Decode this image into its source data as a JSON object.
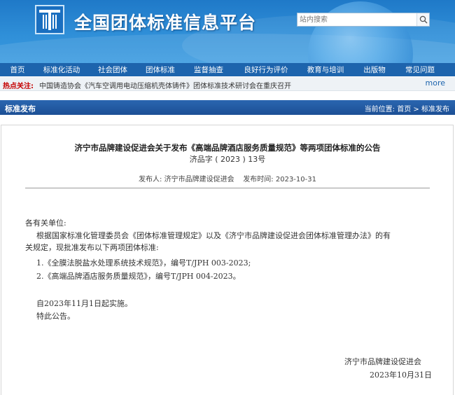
{
  "site": {
    "title": "全国团体标准信息平台"
  },
  "search": {
    "placeholder": "站内搜索"
  },
  "nav": {
    "items": [
      "首页",
      "标准化活动",
      "社会团体",
      "团体标准",
      "监督抽查",
      "良好行为评价",
      "教育与培训",
      "出版物",
      "常见问题"
    ]
  },
  "hot": {
    "label": "热点关注:",
    "text": "中国铸造协会《汽车空调用电动压缩机壳体铸件》团体标准技术研讨会在重庆召开",
    "more": "more"
  },
  "section": {
    "title": "标准发布",
    "location_label": "当前位置:",
    "crumb_home": "首页",
    "crumb_sep": ">",
    "crumb_current": "标准发布"
  },
  "article": {
    "title": "济宁市品牌建设促进会关于发布《高端品牌酒店服务质量规范》等两项团体标准的公告",
    "number": "济品字 ( 2023 ) 13号",
    "publisher_label": "发布人:",
    "publisher": "济宁市品牌建设促进会",
    "time_label": "发布时间:",
    "time": "2023-10-31",
    "greeting": "各有关单位:",
    "para1_line1": "根据国家标准化管理委员会《团体标准管理规定》以及《济宁市品牌建设促进会团体标准管理办法》的有",
    "para1_line2": "关规定，现批准发布以下两项团体标准:",
    "item1": "1.《全膜法脱盐水处理系统技术规范》，编号T/JPH 003-2023;",
    "item2": "2.《高端品牌酒店服务质量规范》，编号T/JPH 004-2023。",
    "effective": "自2023年11月1日起实施。",
    "closing": "特此公告。",
    "signature": "济宁市品牌建设促进会",
    "sign_date": "2023年10月31日"
  }
}
